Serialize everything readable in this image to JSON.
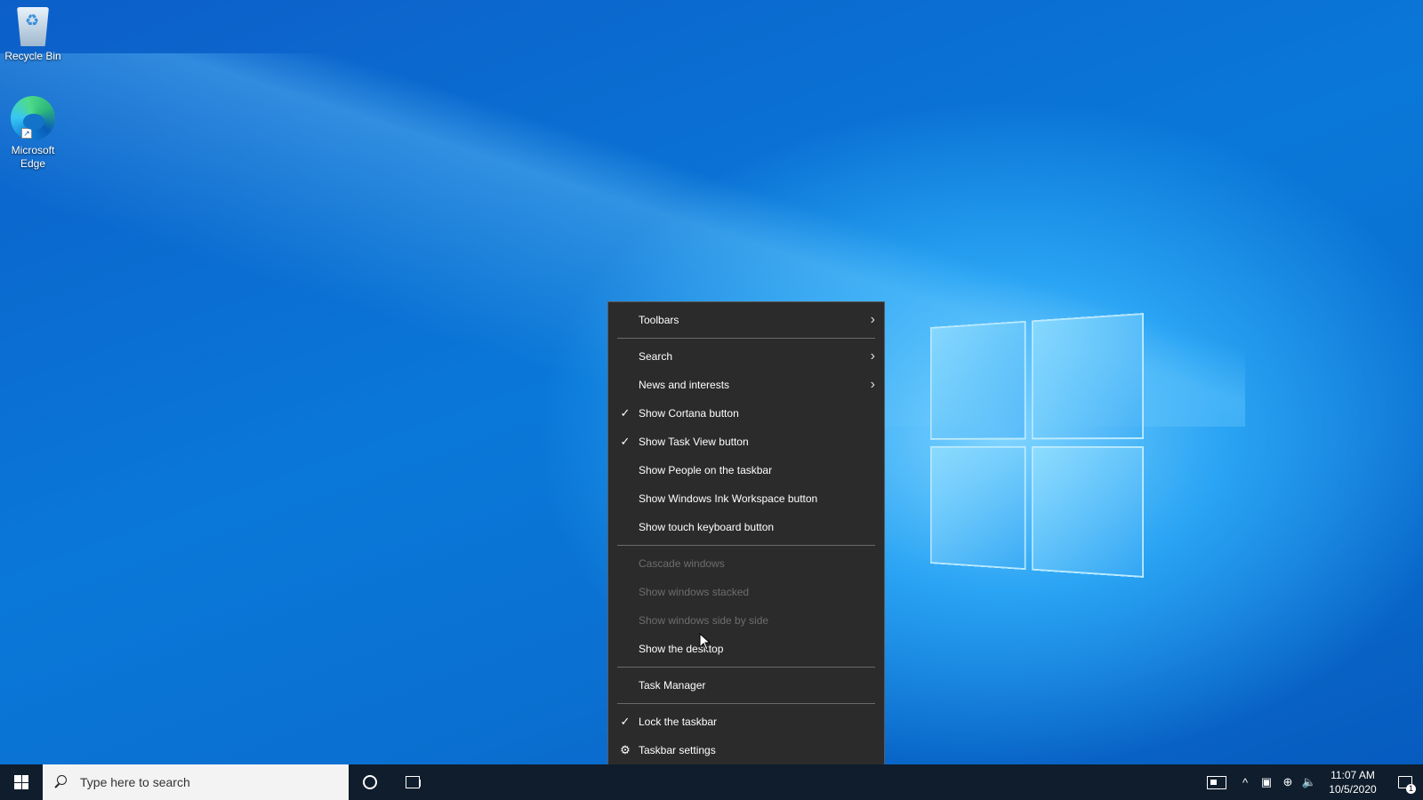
{
  "desktop": {
    "icons": [
      {
        "label": "Recycle Bin",
        "icon": "recycle-bin-icon"
      },
      {
        "label": "Microsoft Edge",
        "icon": "edge-icon"
      }
    ]
  },
  "context_menu": {
    "items": [
      {
        "label": "Toolbars",
        "submenu": true
      },
      {
        "label": "Search",
        "submenu": true
      },
      {
        "label": "News and interests",
        "submenu": true
      },
      {
        "label": "Show Cortana button",
        "checked": true
      },
      {
        "label": "Show Task View button",
        "checked": true
      },
      {
        "label": "Show People on the taskbar"
      },
      {
        "label": "Show Windows Ink Workspace button"
      },
      {
        "label": "Show touch keyboard button"
      },
      {
        "label": "Cascade windows",
        "disabled": true
      },
      {
        "label": "Show windows stacked",
        "disabled": true
      },
      {
        "label": "Show windows side by side",
        "disabled": true
      },
      {
        "label": "Show the desktop"
      },
      {
        "label": "Task Manager"
      },
      {
        "label": "Lock the taskbar",
        "checked": true
      },
      {
        "label": "Taskbar settings",
        "icon": "gear-icon"
      }
    ]
  },
  "taskbar": {
    "search_placeholder": "Type here to search",
    "clock_time": "11:07 AM",
    "clock_date": "10/5/2020",
    "notification_count": "1"
  },
  "colors": {
    "menu_bg": "#2b2b2b",
    "taskbar_bg": "#0f1d2c",
    "disabled_text": "#6d6d6d"
  }
}
